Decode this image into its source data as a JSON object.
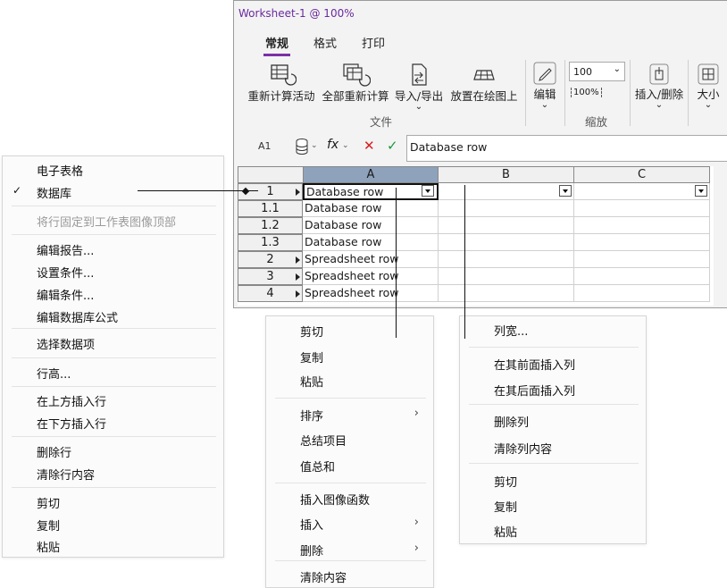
{
  "window": {
    "title": "Worksheet-1 @ 100%",
    "tabs": [
      "常规",
      "格式",
      "打印"
    ],
    "ribbon": {
      "buttons": [
        "重新计算活动",
        "全部重新计算",
        "导入/导出",
        "放置在绘图上"
      ],
      "file_group_label": "文件",
      "edit_label": "编辑",
      "zoom_value": "100",
      "zoom_btn": "100%",
      "zoom_group_label": "缩放",
      "insert_delete_label": "插入/删除",
      "size_label": "大小"
    },
    "formula_bar": {
      "cell_ref": "A1",
      "fx": "fx",
      "value": "Database row"
    },
    "grid": {
      "columns": [
        "A",
        "B",
        "C"
      ],
      "rows": [
        {
          "header": "1",
          "a": "Database row"
        },
        {
          "header": "1.1",
          "a": "Database row"
        },
        {
          "header": "1.2",
          "a": "Database row"
        },
        {
          "header": "1.3",
          "a": "Database row"
        },
        {
          "header": "2",
          "a": "Spreadsheet row"
        },
        {
          "header": "3",
          "a": "Spreadsheet row"
        },
        {
          "header": "4",
          "a": "Spreadsheet row"
        }
      ]
    }
  },
  "row_menu": {
    "items": [
      {
        "label": "电子表格",
        "disabled": false,
        "checked": false
      },
      {
        "label": "数据库",
        "disabled": false,
        "checked": true
      },
      {
        "label": "将行固定到工作表图像顶部",
        "disabled": true,
        "checked": false
      },
      {
        "label": "编辑报告...",
        "disabled": false,
        "checked": false
      },
      {
        "label": "设置条件...",
        "disabled": false,
        "checked": false
      },
      {
        "label": "编辑条件...",
        "disabled": false,
        "checked": false
      },
      {
        "label": "编辑数据库公式",
        "disabled": false,
        "checked": false
      },
      {
        "label": "选择数据项",
        "disabled": false,
        "checked": false
      },
      {
        "label": "行高...",
        "disabled": false,
        "checked": false
      },
      {
        "label": "在上方插入行",
        "disabled": false,
        "checked": false
      },
      {
        "label": "在下方插入行",
        "disabled": false,
        "checked": false
      },
      {
        "label": "删除行",
        "disabled": false,
        "checked": false
      },
      {
        "label": "清除行内容",
        "disabled": false,
        "checked": false
      },
      {
        "label": "剪切",
        "disabled": false,
        "checked": false
      },
      {
        "label": "复制",
        "disabled": false,
        "checked": false
      },
      {
        "label": "粘贴",
        "disabled": false,
        "checked": false
      }
    ],
    "check_glyph": "✓"
  },
  "cell_menu": {
    "items": [
      {
        "label": "剪切"
      },
      {
        "label": "复制"
      },
      {
        "label": "粘贴"
      },
      {
        "label": "排序",
        "submenu": true
      },
      {
        "label": "总结项目"
      },
      {
        "label": "值总和"
      },
      {
        "label": "插入图像函数"
      },
      {
        "label": "插入",
        "submenu": true
      },
      {
        "label": "删除",
        "submenu": true
      },
      {
        "label": "清除内容"
      }
    ]
  },
  "column_menu": {
    "items": [
      {
        "label": "列宽..."
      },
      {
        "label": "在其前面插入列"
      },
      {
        "label": "在其后面插入列"
      },
      {
        "label": "删除列"
      },
      {
        "label": "清除列内容"
      },
      {
        "label": "剪切"
      },
      {
        "label": "复制"
      },
      {
        "label": "粘贴"
      }
    ]
  },
  "colors": {
    "title_text": "#6a2a9e",
    "tab_accent": "#7b2fa8",
    "selected_column_header": "#8ea2bc",
    "cancel_red": "#d42020",
    "confirm_green": "#1a9a3a"
  }
}
